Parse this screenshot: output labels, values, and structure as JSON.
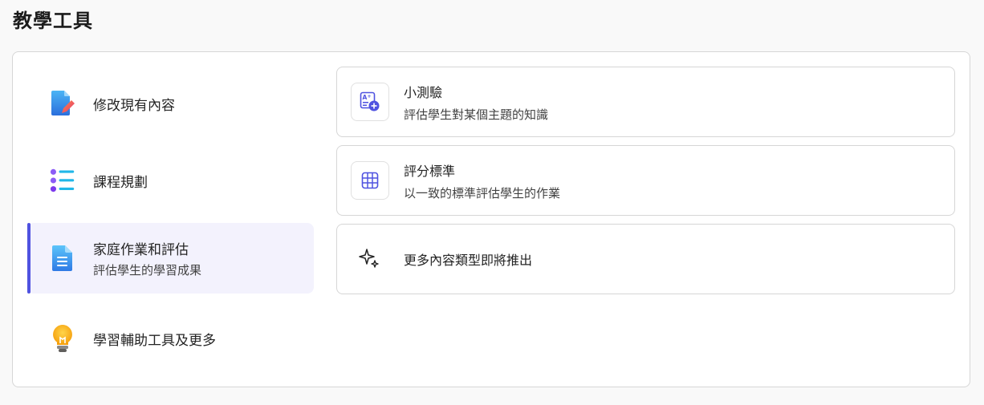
{
  "page": {
    "title": "教學工具"
  },
  "nav": {
    "items": [
      {
        "label": "修改現有內容",
        "icon": "document-pencil-icon"
      },
      {
        "label": "課程規劃",
        "icon": "list-icon"
      },
      {
        "label": "家庭作業和評估",
        "sub": "評估學生的學習成果",
        "icon": "document-text-icon",
        "active": true
      },
      {
        "label": "學習輔助工具及更多",
        "icon": "lightbulb-icon"
      }
    ]
  },
  "cards": [
    {
      "title": "小測驗",
      "desc": "評估學生對某個主題的知識",
      "icon": "quiz-icon"
    },
    {
      "title": "評分標準",
      "desc": "以一致的標準評估學生的作業",
      "icon": "table-grid-icon"
    },
    {
      "title": "更多內容類型即將推出",
      "icon": "sparkle-icon"
    }
  ],
  "colors": {
    "accent": "#4f52e0",
    "active_bg": "#f3f2fd"
  }
}
